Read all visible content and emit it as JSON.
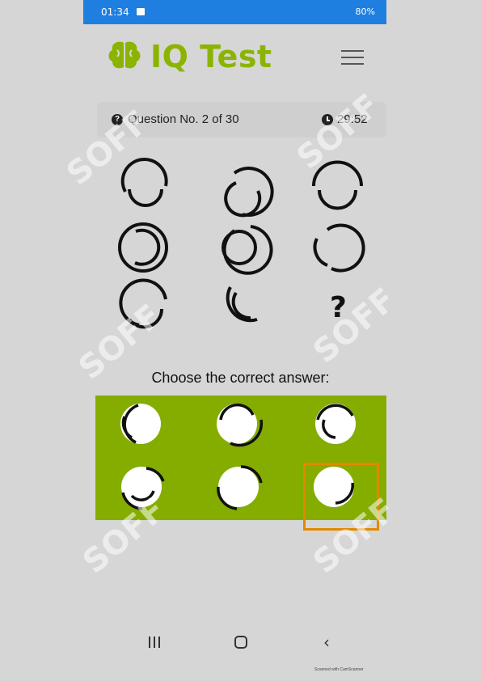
{
  "status_bar": {
    "time": "01:34",
    "right_text": "80%"
  },
  "app": {
    "title": "IQ Test"
  },
  "info": {
    "question_label": "Question No. 2 of 30",
    "timer": "29:52"
  },
  "puzzle": {
    "missing_symbol": "?"
  },
  "answers": {
    "prompt": "Choose the correct answer:",
    "highlighted_option": 6
  },
  "watermark": {
    "text": "SOFF"
  },
  "footer": {
    "note": "Scanned with CamScanner"
  },
  "colors": {
    "accent": "#8bb400",
    "panel": "#84ad00",
    "highlight": "#e08a00",
    "status_bar": "#1f7fe0"
  },
  "icons": [
    "image-icon",
    "brain-logo-icon",
    "menu-icon",
    "question-circle-icon",
    "clock-icon",
    "recent-apps-icon",
    "home-icon",
    "back-icon"
  ]
}
